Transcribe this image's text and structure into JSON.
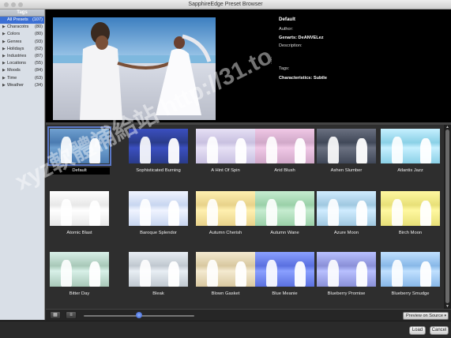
{
  "window": {
    "title": "SapphireEdge Preset Browser"
  },
  "tags_panel": {
    "header": "Tags",
    "items": [
      {
        "label": "All Presets",
        "count": "(107)",
        "selected": true,
        "expandable": false
      },
      {
        "label": "Characotrs",
        "count": "(80)",
        "selected": false,
        "expandable": true
      },
      {
        "label": "Colors",
        "count": "(80)",
        "selected": false,
        "expandable": true
      },
      {
        "label": "Genres",
        "count": "(93)",
        "selected": false,
        "expandable": true
      },
      {
        "label": "Holidays",
        "count": "(62)",
        "selected": false,
        "expandable": true
      },
      {
        "label": "Industries",
        "count": "(87)",
        "selected": false,
        "expandable": true
      },
      {
        "label": "Locations",
        "count": "(55)",
        "selected": false,
        "expandable": true
      },
      {
        "label": "Moods",
        "count": "(84)",
        "selected": false,
        "expandable": true
      },
      {
        "label": "Time",
        "count": "(63)",
        "selected": false,
        "expandable": true
      },
      {
        "label": "Weather",
        "count": "(34)",
        "selected": false,
        "expandable": true
      }
    ]
  },
  "info": {
    "title": "Default",
    "author_label": "Author:",
    "genarts": "Genarts: DeANVELez",
    "description_label": "Description:",
    "tags_label": "Tags:",
    "characteristics": "Characteristics: Subtle"
  },
  "presets": [
    {
      "label": "Default",
      "tint": "#4a7ab0",
      "sky": "#6fa0d0",
      "selected": true
    },
    {
      "label": "Sophisticated Burning",
      "tint": "#2a3c8a",
      "sky": "#3b4fc0",
      "selected": false
    },
    {
      "label": "A Hint Of Spin",
      "tint": "#c8c0e0",
      "sky": "#e6e0f5",
      "selected": false
    },
    {
      "label": "Arid Blush",
      "tint": "#d0a8c8",
      "sky": "#f0c8e6",
      "selected": false
    },
    {
      "label": "Ashen Slumber",
      "tint": "#404858",
      "sky": "#6a7080",
      "selected": false
    },
    {
      "label": "Atlantis Jazz",
      "tint": "#8ad0e6",
      "sky": "#c6f0ff",
      "selected": false
    },
    {
      "label": "Atomic Blast",
      "tint": "#e8e8e8",
      "sky": "#ffffff",
      "selected": false
    },
    {
      "label": "Baroque Splendor",
      "tint": "#c8d6f0",
      "sky": "#f0f4ff",
      "selected": false
    },
    {
      "label": "Autumn Cherish",
      "tint": "#e8d28a",
      "sky": "#fff0b0",
      "selected": false
    },
    {
      "label": "Autumn Wane",
      "tint": "#9ad0a8",
      "sky": "#c6ecd0",
      "selected": false
    },
    {
      "label": "Azure Moon",
      "tint": "#a0c8e0",
      "sky": "#d0ecff",
      "selected": false
    },
    {
      "label": "Birch Moon",
      "tint": "#e8e078",
      "sky": "#fff8a0",
      "selected": false
    },
    {
      "label": "Bitter Day",
      "tint": "#a8c8b8",
      "sky": "#d8f0e8",
      "selected": false
    },
    {
      "label": "Bleak",
      "tint": "#c0c8d0",
      "sky": "#e8eef4",
      "selected": false
    },
    {
      "label": "Blown Gasket",
      "tint": "#d8c8a0",
      "sky": "#f4ead0",
      "selected": false
    },
    {
      "label": "Blue Meanie",
      "tint": "#5a70e0",
      "sky": "#8aa0ff",
      "selected": false
    },
    {
      "label": "Blueberry Promise",
      "tint": "#8a90d8",
      "sky": "#b8c0ff",
      "selected": false
    },
    {
      "label": "Blueberry Smudge",
      "tint": "#88b8e8",
      "sky": "#c0e0ff",
      "selected": false
    }
  ],
  "bottom_bar": {
    "grid_view_icon": "grid-icon",
    "list_view_icon": "list-icon",
    "thumbnail_size_level": 0.5,
    "preview_select": "Preview on Source"
  },
  "footer": {
    "load_label": "Load",
    "cancel_label": "Cancel"
  },
  "watermark": {
    "line1": "xyz軟體補給站 http://31.to"
  }
}
